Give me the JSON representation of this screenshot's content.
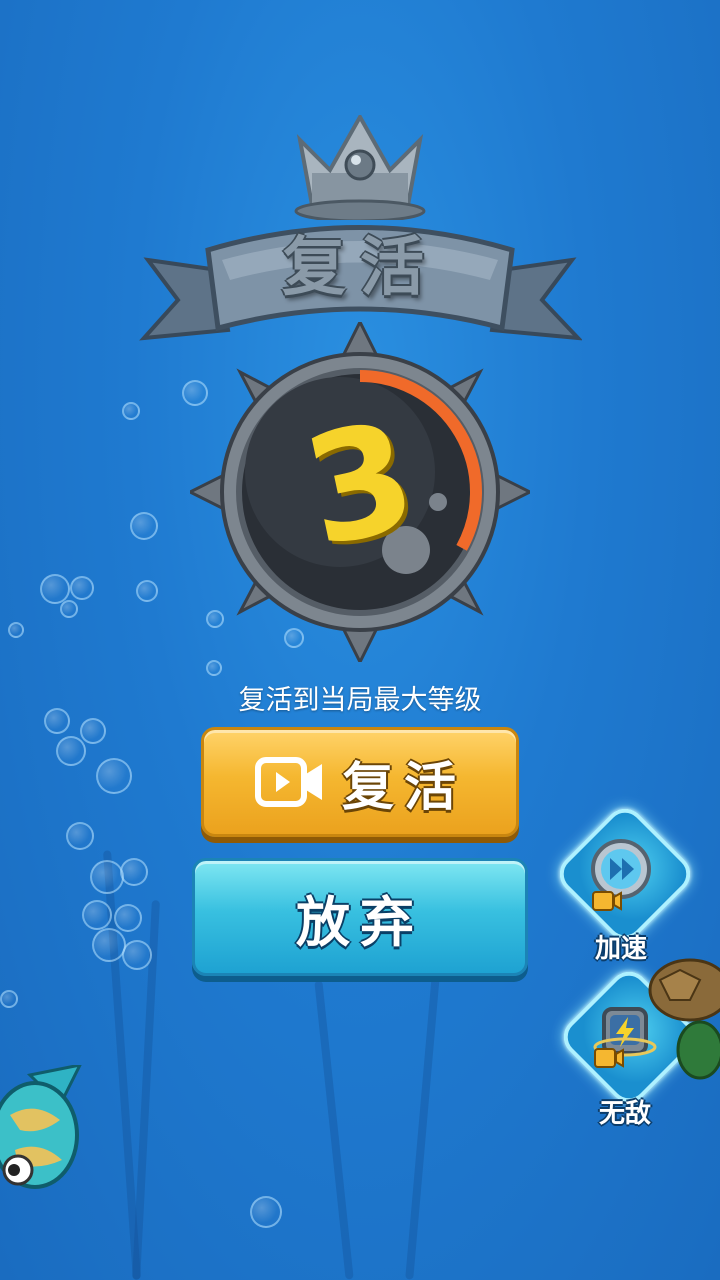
{
  "dialog": {
    "title": "复活",
    "countdown": "3",
    "countdown_progress": 0.33,
    "subtitle": "复活到当局最大等级"
  },
  "buttons": {
    "revive_label": "复活",
    "revive_icon": "video-icon",
    "giveup_label": "放弃"
  },
  "powerups": [
    {
      "label": "加速",
      "icon": "fast-forward-icon",
      "badge": "video-icon"
    },
    {
      "label": "无敌",
      "icon": "shield-lightning-icon",
      "badge": "video-icon"
    }
  ],
  "colors": {
    "background": "#1f7ad0",
    "countdown_digit": "#f6d32b",
    "countdown_ring": "#f06a2a",
    "revive_button": "#f5b730",
    "giveup_button": "#38c0e0"
  }
}
